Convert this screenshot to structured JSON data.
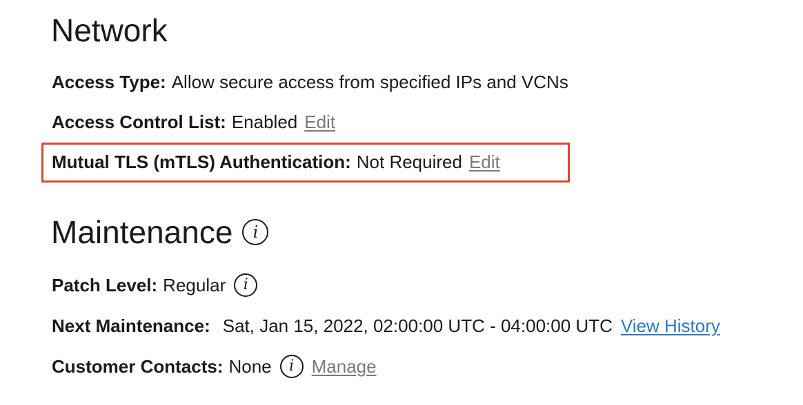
{
  "network": {
    "title": "Network",
    "access_type": {
      "label": "Access Type:",
      "value": "Allow secure access from specified IPs and VCNs"
    },
    "acl": {
      "label": "Access Control List:",
      "value": "Enabled",
      "edit_label": "Edit"
    },
    "mtls": {
      "label": "Mutual TLS (mTLS) Authentication:",
      "value": "Not Required",
      "edit_label": "Edit",
      "highlight_color": "#e0462e"
    }
  },
  "maintenance": {
    "title": "Maintenance",
    "info_icon": "info-icon",
    "patch_level": {
      "label": "Patch Level:",
      "value": "Regular",
      "info_icon": "info-icon"
    },
    "next_maintenance": {
      "label": "Next Maintenance:",
      "value": "Sat, Jan 15, 2022, 02:00:00 UTC - 04:00:00 UTC",
      "link_label": "View History",
      "link_color": "#2d7ac0"
    },
    "customer_contacts": {
      "label": "Customer Contacts:",
      "value": "None",
      "info_icon": "info-icon",
      "link_label": "Manage"
    }
  }
}
